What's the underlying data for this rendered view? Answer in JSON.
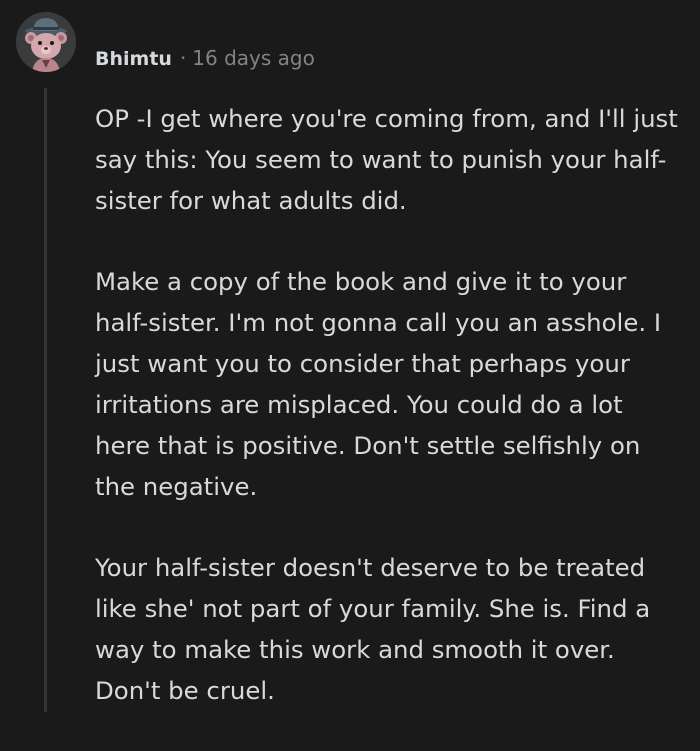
{
  "comment": {
    "author": "Bhimtu",
    "separator": "·",
    "timestamp": "16 days ago",
    "avatar_icon": "bear-with-hat-avatar-icon",
    "paragraphs": [
      "OP -I get where you're coming from, and I'll just say this: You seem to want to punish your half-sister for what adults did.",
      "Make a copy of the book and give it to your half-sister. I'm not gonna call you an asshole. I just want you to consider that perhaps your irritations are misplaced. You could do a lot here that is positive. Don't settle selfishly on the negative.",
      "Your half-sister doesn't deserve to be treated like she' not part of your family. She is. Find a way to make this work and smooth it over. Don't be cruel."
    ]
  },
  "colors": {
    "background": "#1a1a1b",
    "text": "#d7dadc",
    "muted": "#818384",
    "thread_line": "#343536"
  }
}
